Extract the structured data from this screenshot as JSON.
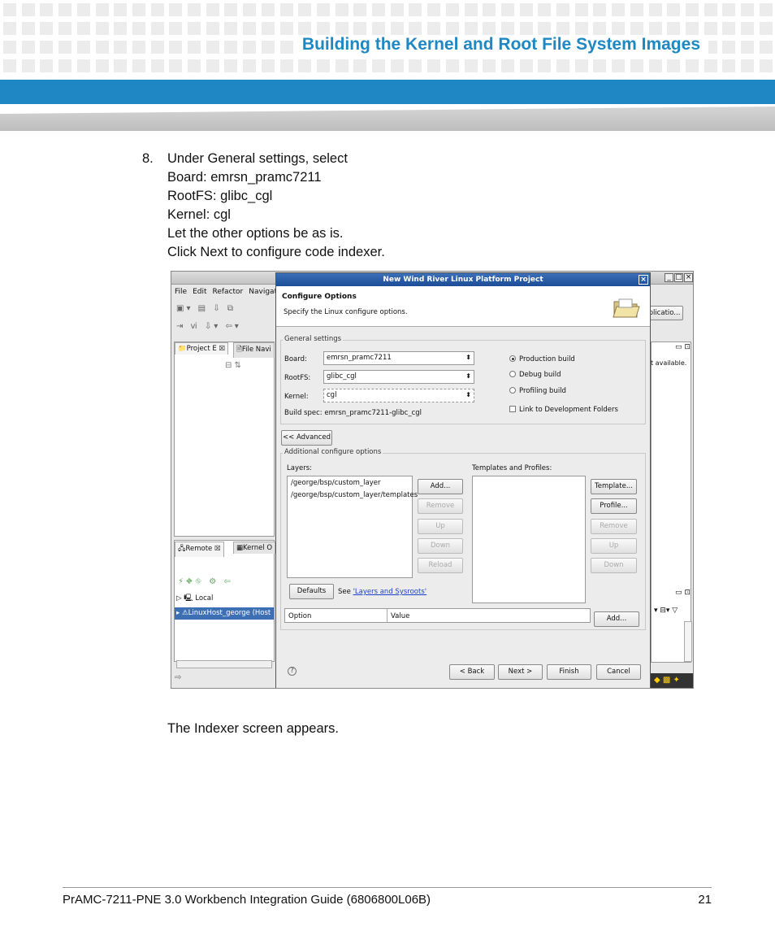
{
  "header": {
    "title": "Building the Kernel and Root File System Images"
  },
  "step": {
    "number": "8.",
    "lines": [
      "Under General settings, select",
      "Board: emrsn_pramc7211",
      "RootFS: glibc_cgl",
      "Kernel: cgl",
      "Let the other options be as is.",
      "Click Next to configure code indexer."
    ]
  },
  "screenshot": {
    "ide": {
      "menu": [
        "File",
        "Edit",
        "Refactor",
        "Navigate"
      ],
      "tabs": {
        "project": "Project E",
        "file_nav": "File Navi",
        "remote": "Remote",
        "kernel": "Kernel O"
      },
      "tree": {
        "local": "Local",
        "host": "LinuxHost_george (Host"
      },
      "right_text": {
        "application": "plicatio...",
        "available": "t available."
      }
    },
    "dialog": {
      "title": "New Wind River Linux Platform Project",
      "heading": "Configure Options",
      "subheading": "Specify the Linux configure options.",
      "general_settings": {
        "label": "General settings",
        "board_label": "Board:",
        "board_value": "emrsn_pramc7211",
        "rootfs_label": "RootFS:",
        "rootfs_value": "glibc_cgl",
        "kernel_label": "Kernel:",
        "kernel_value": "cgl",
        "build_spec_label": "Build spec:",
        "build_spec_value": "emrsn_pramc7211-glibc_cgl",
        "options": [
          {
            "label": "Production build",
            "selected": true
          },
          {
            "label": "Debug build",
            "selected": false
          },
          {
            "label": "Profiling build",
            "selected": false
          }
        ],
        "link_folders": "Link to Development Folders"
      },
      "advanced_button": "<< Advanced",
      "additional": {
        "label": "Additional configure options",
        "layers_label": "Layers:",
        "layers": [
          "/george/bsp/custom_layer",
          "/george/bsp/custom_layer/templates"
        ],
        "layer_buttons": [
          "Add...",
          "Remove",
          "Up",
          "Down",
          "Reload"
        ],
        "templates_label": "Templates and Profiles:",
        "template_buttons": [
          "Template...",
          "Profile...",
          "Remove",
          "Up",
          "Down"
        ],
        "defaults_button": "Defaults",
        "see_text": "See",
        "see_link": "'Layers and Sysroots'",
        "option_col": "Option",
        "value_col": "Value",
        "add_button": "Add..."
      },
      "footer_buttons": {
        "back": "< Back",
        "next": "Next >",
        "finish": "Finish",
        "cancel": "Cancel"
      }
    }
  },
  "caption": "The Indexer screen appears.",
  "footer": {
    "doc_title": "PrAMC-7211-PNE 3.0  Workbench Integration Guide (6806800L06B)",
    "page_number": "21"
  },
  "colors": {
    "accent_blue": "#1f87c4",
    "title_blue": "#1d88c2"
  }
}
